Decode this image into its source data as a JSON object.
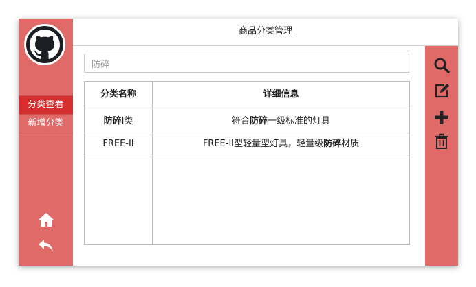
{
  "header": {
    "title": "商品分类管理"
  },
  "sidebar": {
    "items": [
      {
        "label": "分类查看",
        "active": true
      },
      {
        "label": "新增分类",
        "active": false
      }
    ],
    "bottom_icons": [
      "home-icon",
      "back-arrow-icon"
    ]
  },
  "search": {
    "value": "防碎"
  },
  "table": {
    "headers": [
      "分类名称",
      "详细信息"
    ],
    "rows": [
      {
        "name": {
          "before": "",
          "highlight": "防碎",
          "after": "I类"
        },
        "detail": {
          "before": "符合",
          "highlight": "防碎",
          "after": "一级标准的灯具"
        }
      },
      {
        "name": {
          "before": "FREE-II",
          "highlight": "",
          "after": ""
        },
        "detail": {
          "before": "FREE-II型轻量型灯具，轻量级",
          "highlight": "防碎",
          "after": "材质"
        }
      }
    ]
  },
  "toolbar": {
    "icons": [
      "search-icon",
      "edit-icon",
      "add-icon",
      "delete-icon"
    ]
  },
  "colors": {
    "accent": "#e06a68",
    "active": "#d52e2e",
    "border": "#bdbdbd"
  }
}
